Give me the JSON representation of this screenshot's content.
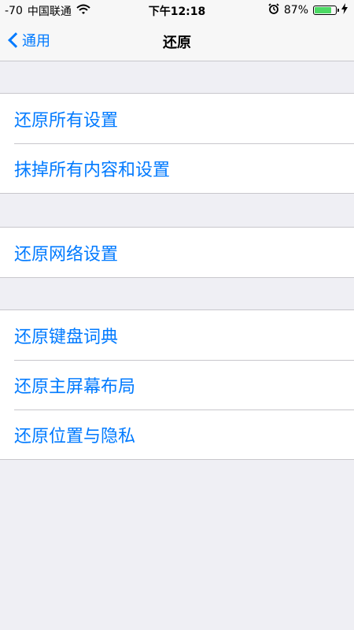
{
  "status_bar": {
    "signal": "-70",
    "carrier": "中国联通",
    "wifi_icon": "wifi-icon",
    "time": "下午12:18",
    "alarm_icon": "alarm-icon",
    "battery_percent": "87%",
    "battery_level": 0.87,
    "charging_icon": "bolt-icon"
  },
  "nav": {
    "back_label": "通用",
    "title": "还原"
  },
  "groups": [
    {
      "items": [
        {
          "label": "还原所有设置"
        },
        {
          "label": "抹掉所有内容和设置"
        }
      ]
    },
    {
      "items": [
        {
          "label": "还原网络设置"
        }
      ]
    },
    {
      "items": [
        {
          "label": "还原键盘词典"
        },
        {
          "label": "还原主屏幕布局"
        },
        {
          "label": "还原位置与隐私"
        }
      ]
    }
  ],
  "colors": {
    "accent": "#007aff",
    "background": "#efeff4",
    "battery": "#4cd964"
  }
}
